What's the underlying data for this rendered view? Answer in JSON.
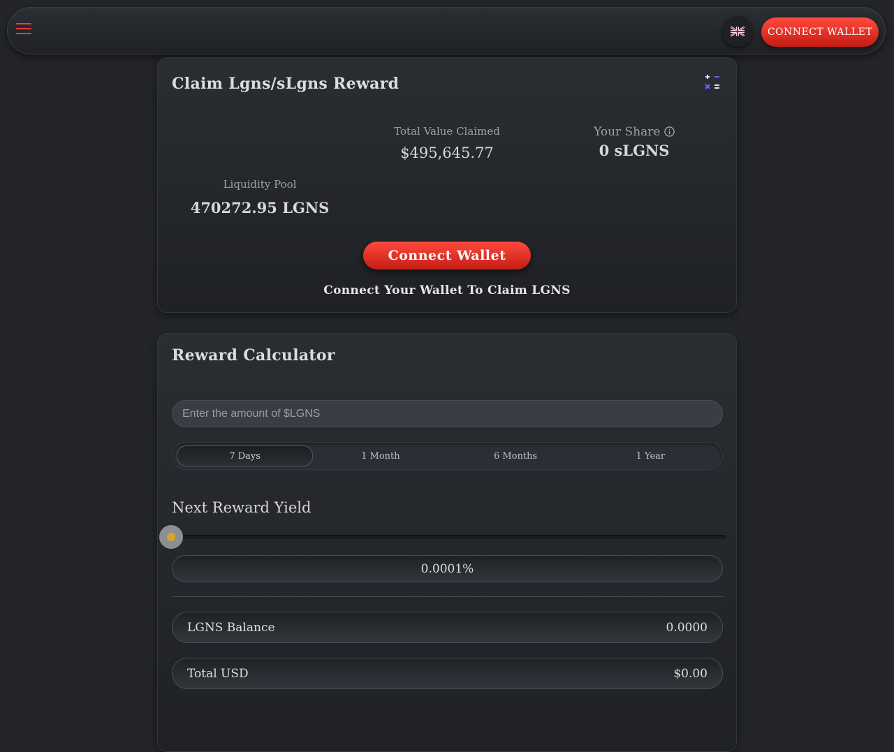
{
  "header": {
    "menu_icon": "hamburger-menu-icon",
    "language_icon": "uk-flag-icon",
    "connect_label": "CONNECT WALLET",
    "accent": "#ff3b3b"
  },
  "claim": {
    "title": "Claim Lgns/sLgns Reward",
    "icon": "calculator-icon",
    "total_value_label": "Total Value Claimed",
    "total_value": "$495,645.77",
    "share_label": "Your Share",
    "share_value": "0 sLGNS",
    "liquidity_label": "Liquidity Pool",
    "liquidity_value": "470272.95 LGNS",
    "connect_label": "Connect Wallet",
    "connect_note": "Connect Your Wallet To Claim LGNS"
  },
  "calculator": {
    "title": "Reward Calculator",
    "amount_placeholder": "Enter the amount of $LGNS",
    "amount_value": "",
    "periods": [
      "7 Days",
      "1 Month",
      "6 Months",
      "1 Year"
    ],
    "selected_period": "7 Days",
    "yield_label": "Next Reward Yield",
    "slider_level": 0,
    "yield_value": "0.0001%",
    "balance_label": "LGNS Balance",
    "balance_value": "0.0000",
    "usd_label": "Total USD",
    "usd_value": "$0.00"
  }
}
